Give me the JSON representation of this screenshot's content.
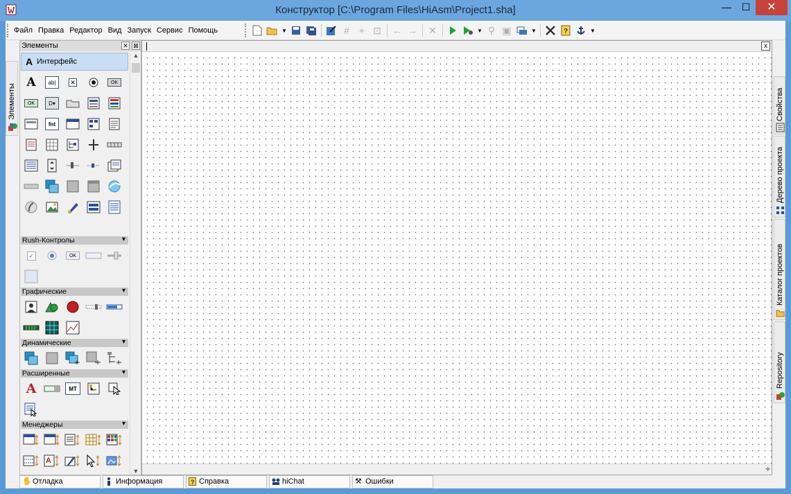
{
  "window": {
    "title": "Конструктор [C:\\Program Files\\HiAsm\\Project1.sha]",
    "minimize": "—",
    "maximize": "☐",
    "close": "✕"
  },
  "menu": {
    "items": [
      "Файл",
      "Правка",
      "Редактор",
      "Вид",
      "Запуск",
      "Сервис",
      "Помощь"
    ]
  },
  "left_tab": {
    "label": "Элементы"
  },
  "elements_panel": {
    "caption": "Элементы",
    "group_title": "Интерфейс",
    "group_icon_letter": "A",
    "sections": [
      "Rush-Контролы",
      "Графические",
      "Динамические",
      "Расширенные",
      "Менеджеры"
    ]
  },
  "canvas": {
    "close": "x"
  },
  "right_tabs": [
    "Свойства",
    "Дерево проекта",
    "Каталог проектов",
    "Repository"
  ],
  "bottom_tabs": [
    "Отладка",
    "Информация",
    "Справка",
    "hiChat",
    "Ошибки"
  ],
  "colors": {
    "titlebar": "#6ba6df",
    "close_button": "#c7423a",
    "group_header": "#c9def4"
  }
}
